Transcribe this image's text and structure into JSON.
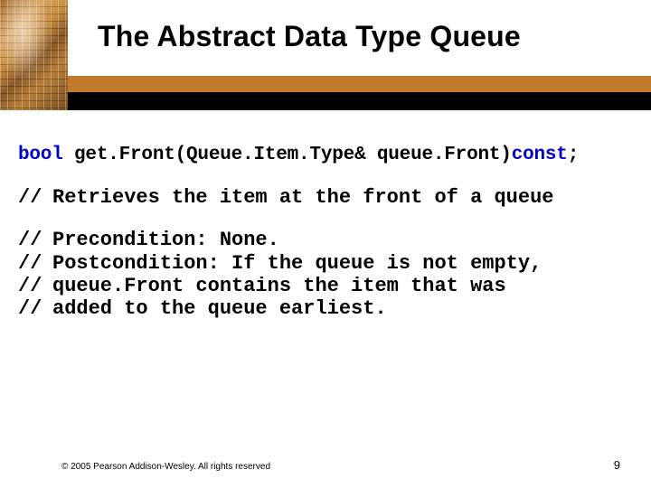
{
  "slide": {
    "title": "The Abstract Data Type Queue",
    "code": {
      "kw_bool": "bool",
      "sig_mid": " get.Front(Queue.Item.Type& queue.Front)",
      "kw_const": "const",
      "sig_tail": ";"
    },
    "comment": {
      "prefix": "//",
      "line1": "Retrieves the item at the front of a queue"
    },
    "prepost": {
      "prefix": "//",
      "line1": "Precondition: None.",
      "line2": "Postcondition: If the queue is not empty,",
      "line3": "queue.Front contains the item that was",
      "line4": "added to the queue earliest."
    },
    "footer": {
      "copyright": "© 2005 Pearson Addison-Wesley. All rights reserved",
      "page": "9"
    }
  }
}
